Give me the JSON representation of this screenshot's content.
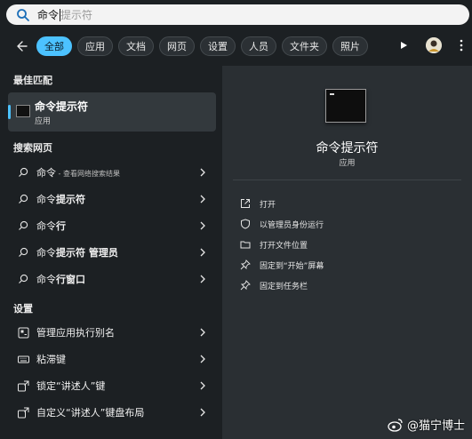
{
  "search": {
    "value": "命令",
    "placeholder": "提示符",
    "icon": "search-icon"
  },
  "filters": {
    "back_icon": "arrow-left-icon",
    "chips": [
      {
        "label": "全部",
        "active": true
      },
      {
        "label": "应用",
        "active": false
      },
      {
        "label": "文档",
        "active": false
      },
      {
        "label": "网页",
        "active": false
      },
      {
        "label": "设置",
        "active": false
      },
      {
        "label": "人员",
        "active": false
      },
      {
        "label": "文件夹",
        "active": false
      },
      {
        "label": "照片",
        "active": false
      }
    ],
    "play_icon": "play-icon",
    "avatar_icon": "avatar-icon",
    "more_icon": "more-icon"
  },
  "left": {
    "best_match_title": "最佳匹配",
    "best_match": {
      "name": "命令提示符",
      "kind": "应用"
    },
    "web_title": "搜索网页",
    "web_items": [
      {
        "prefix": "命令",
        "bold": "",
        "suffix": " - 查看网络搜索结果"
      },
      {
        "prefix": "命令",
        "bold": "提示符",
        "suffix": ""
      },
      {
        "prefix": "命令",
        "bold": "行",
        "suffix": ""
      },
      {
        "prefix": "命令",
        "bold": "提示符 管理员",
        "suffix": ""
      },
      {
        "prefix": "命令",
        "bold": "行窗口",
        "suffix": ""
      }
    ],
    "settings_title": "设置",
    "settings_items": [
      {
        "label": "管理应用执行别名",
        "icon": "app-alias-icon"
      },
      {
        "label": "粘滞键",
        "icon": "keyboard-icon"
      },
      {
        "label": "锁定“讲述人”键",
        "icon": "narrator-icon"
      },
      {
        "label": "自定义“讲述人”键盘布局",
        "icon": "narrator-icon"
      }
    ]
  },
  "right": {
    "app_name": "命令提示符",
    "app_kind": "应用",
    "actions": [
      {
        "label": "打开",
        "icon": "open-icon"
      },
      {
        "label": "以管理员身份运行",
        "icon": "shield-icon"
      },
      {
        "label": "打开文件位置",
        "icon": "folder-icon"
      },
      {
        "label": "固定到“开始”屏幕",
        "icon": "pin-icon"
      },
      {
        "label": "固定到任务栏",
        "icon": "pin-icon"
      }
    ]
  },
  "watermark": {
    "text": "@猫宁博士"
  },
  "colors": {
    "accent": "#4cc2ff",
    "background": "#1c2023",
    "panel": "#2a2f33"
  }
}
